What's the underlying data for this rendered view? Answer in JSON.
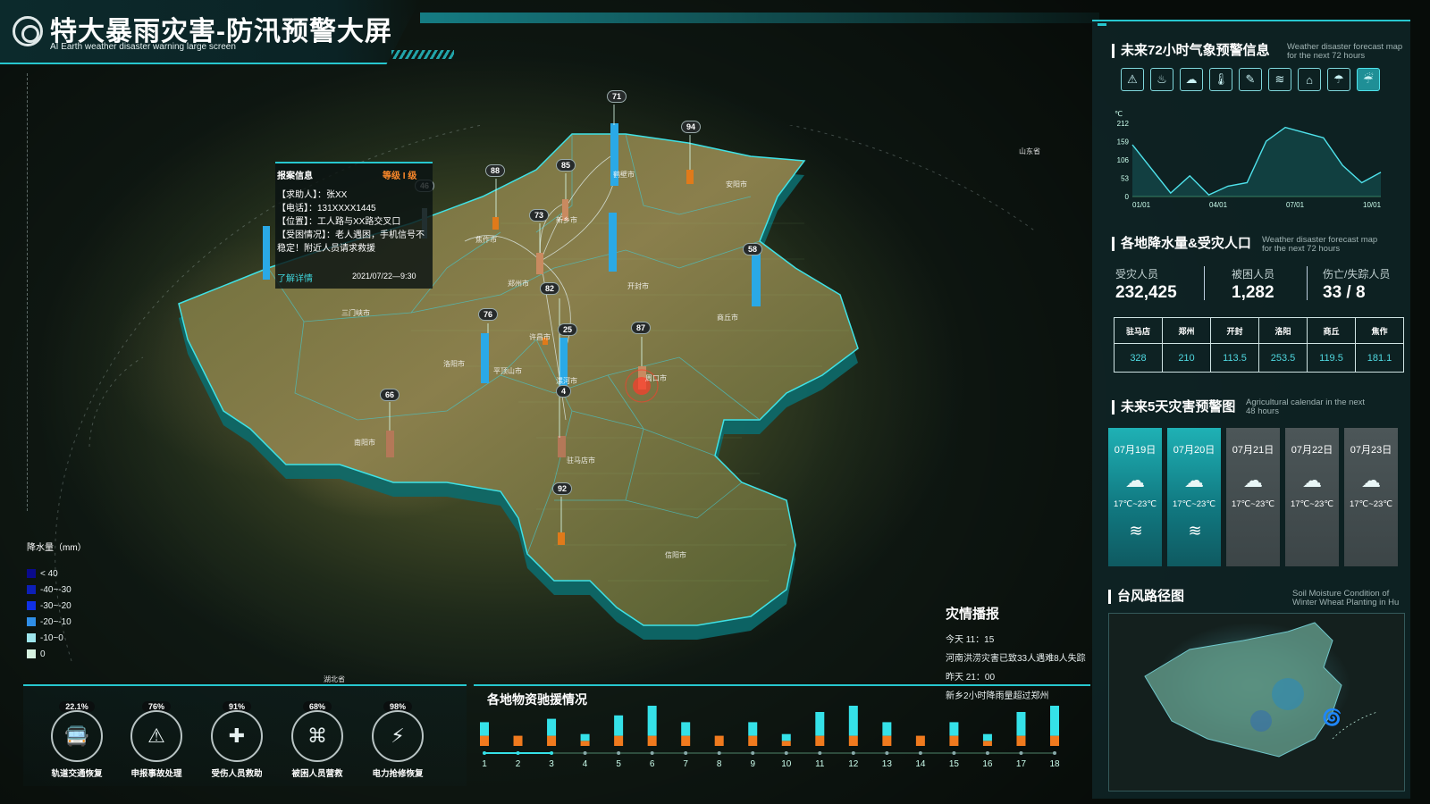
{
  "header": {
    "title": "特大暴雨灾害-防汛预警大屏",
    "subtitle": "AI Earth weather disaster warning large screen"
  },
  "popup": {
    "title": "报案信息",
    "level": "等级 I 级",
    "caller": "【求助人】：张XX",
    "phone": "【电话】：131XXXX1445",
    "location": "【位置】：工人路与XX路交叉口",
    "situation": "【受困情况】：老人遇困，手机信号不稳定！附近人员请求救援",
    "link": "了解详情",
    "time": "2021/07/22—9:30"
  },
  "map_pins": [
    "71",
    "94",
    "88",
    "85",
    "46",
    "73",
    "82",
    "76",
    "25",
    "87",
    "4",
    "66",
    "92",
    "58"
  ],
  "cities": [
    "鹤壁市",
    "安阳市",
    "焦作市",
    "新乡市",
    "郑州市",
    "开封市",
    "商丘市",
    "洛阳市",
    "许昌市",
    "三门峡市",
    "平顶山市",
    "漯河市",
    "周口市",
    "驻马店市",
    "南阳市",
    "信阳市",
    "湖北省",
    "山东省"
  ],
  "legend": {
    "title": "降水量（mm）",
    "items": [
      {
        "label": "< 40",
        "color": "#0a0a8c"
      },
      {
        "label": "-40~-30",
        "color": "#0d1fb8"
      },
      {
        "label": "-30~-20",
        "color": "#1030e6"
      },
      {
        "label": "-20~-10",
        "color": "#2f8fe8"
      },
      {
        "label": "-10~0",
        "color": "#9ee6ec"
      },
      {
        "label": "0",
        "color": "#d6f2e0"
      }
    ]
  },
  "gauges": [
    {
      "pct": "22.1%",
      "label": "轨道交通恢复",
      "icon": "bus-icon",
      "glyph": "🚍"
    },
    {
      "pct": "76%",
      "label": "申报事故处理",
      "icon": "accident-icon",
      "glyph": "⚠"
    },
    {
      "pct": "91%",
      "label": "受伤人员救助",
      "icon": "medical-cross-icon",
      "glyph": "✚"
    },
    {
      "pct": "68%",
      "label": "被困人员营救",
      "icon": "rescue-icon",
      "glyph": "⌘"
    },
    {
      "pct": "98%",
      "label": "电力抢修恢复",
      "icon": "lightning-icon",
      "glyph": "⚡"
    }
  ],
  "supplies": {
    "title": "各地物资驰援情况",
    "slider": {
      "start": 1,
      "end": 3
    }
  },
  "news": {
    "title": "灾情播报",
    "lines": [
      "今天 11：15",
      "河南洪涝灾害已致33人遇难8人失踪",
      "昨天 21：00",
      "新乡2小时降雨量超过郑州"
    ]
  },
  "right": {
    "weather72": {
      "title": "未来72小时气象预警信息",
      "sub": "Weather disaster forecast map for the next 72 hours",
      "icons": [
        "warning-icon",
        "heat-icon",
        "rain-cloud-icon",
        "thermometer-icon",
        "wind-icon",
        "gale-icon",
        "flood-icon",
        "storm-icon",
        "rainstorm-icon"
      ],
      "glyphs": [
        "⚠",
        "♨",
        "☁",
        "🌡",
        "✎",
        "≋",
        "⌂",
        "☂",
        "☔"
      ],
      "active_index": 8
    },
    "rain": {
      "title": "各地降水量&受灾人口",
      "sub": "Weather disaster forecast map for the next 72 hours",
      "stats": [
        {
          "label": "受灾人员",
          "value": "232,425"
        },
        {
          "label": "被困人员",
          "value": "1,282"
        },
        {
          "label": "伤亡/失踪人员",
          "value": "33 / 8"
        }
      ],
      "table_headers": [
        "驻马店",
        "郑州",
        "开封",
        "洛阳",
        "商丘",
        "焦作"
      ],
      "table_values": [
        "328",
        "210",
        "113.5",
        "253.5",
        "119.5",
        "181.1"
      ]
    },
    "forecast": {
      "title": "未来5天灾害预警图",
      "sub": "Agricultural calendar in the next 48 hours",
      "days": [
        {
          "date": "07月19日",
          "temp": "17℃~23℃",
          "heat": true
        },
        {
          "date": "07月20日",
          "temp": "17℃~23℃",
          "heat": true
        },
        {
          "date": "07月21日",
          "temp": "17℃~23℃",
          "heat": false
        },
        {
          "date": "07月22日",
          "temp": "17℃~23℃",
          "heat": false
        },
        {
          "date": "07月23日",
          "temp": "17℃~23℃",
          "heat": false
        }
      ]
    },
    "typhoon": {
      "title": "台风路径图",
      "sub": "Soil Moisture Condition of Winter Wheat Planting in Hu"
    }
  },
  "chart_data": [
    {
      "type": "line",
      "title": "",
      "ylabel": "℃",
      "x": [
        "01/01",
        "04/01",
        "07/01",
        "10/01"
      ],
      "yticks": [
        0,
        53,
        106,
        159,
        212
      ],
      "ylim": [
        0,
        212
      ],
      "series": [
        {
          "values": [
            150,
            80,
            10,
            60,
            5,
            30,
            40,
            160,
            200,
            185,
            170,
            90,
            40,
            70
          ]
        }
      ]
    },
    {
      "type": "bar",
      "title": "各地物资驰援情况",
      "categories": [
        "1",
        "2",
        "3",
        "4",
        "5",
        "6",
        "7",
        "8",
        "9",
        "10",
        "11",
        "12",
        "13",
        "14",
        "15",
        "16",
        "17",
        "18"
      ],
      "series": [
        {
          "values": [
            6,
            6,
            6,
            3,
            6,
            6,
            6,
            6,
            6,
            3,
            6,
            6,
            6,
            6,
            6,
            3,
            6,
            6
          ]
        },
        {
          "values": [
            8,
            0,
            10,
            4,
            12,
            20,
            8,
            0,
            8,
            4,
            14,
            20,
            8,
            0,
            8,
            4,
            14,
            22
          ]
        }
      ]
    }
  ]
}
